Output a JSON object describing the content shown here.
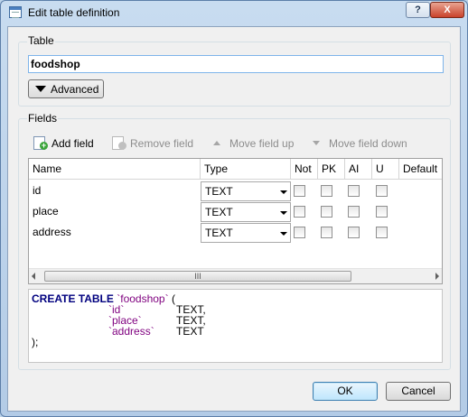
{
  "window": {
    "title": "Edit table definition",
    "help_label": "?",
    "close_label": "X"
  },
  "table_section": {
    "label": "Table",
    "name_value": "foodshop",
    "advanced_label": "Advanced"
  },
  "fields_section": {
    "label": "Fields",
    "toolbar": {
      "add_field": "Add field",
      "remove_field": "Remove field",
      "move_up": "Move field up",
      "move_down": "Move field down"
    },
    "columns": [
      "Name",
      "Type",
      "Not",
      "PK",
      "AI",
      "U",
      "Default"
    ],
    "rows": [
      {
        "name": "id",
        "type": "TEXT",
        "not": false,
        "pk": false,
        "ai": false,
        "u": false
      },
      {
        "name": "place",
        "type": "TEXT",
        "not": false,
        "pk": false,
        "ai": false,
        "u": false
      },
      {
        "name": "address",
        "type": "TEXT",
        "not": false,
        "pk": false,
        "ai": false,
        "u": false
      }
    ],
    "scroll_grip": "III"
  },
  "sql": {
    "keyword": "CREATE TABLE",
    "table_ident": "`foodshop`",
    "open": "(",
    "lines": [
      {
        "ident": "`id`",
        "type": "TEXT,"
      },
      {
        "ident": "`place`",
        "type": "TEXT,"
      },
      {
        "ident": "`address`",
        "type": "TEXT"
      }
    ],
    "close": ");"
  },
  "buttons": {
    "ok": "OK",
    "cancel": "Cancel"
  },
  "colors": {
    "sql_keyword": "#00007f",
    "sql_identifier": "#7f007f",
    "input_border": "#7eb4ea"
  }
}
